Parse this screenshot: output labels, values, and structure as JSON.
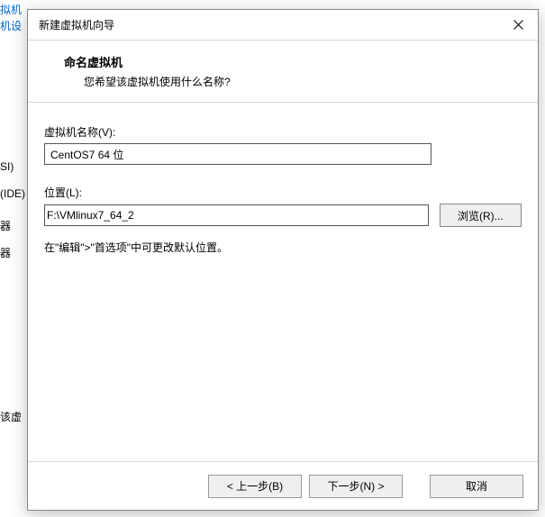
{
  "background": {
    "link1": "拟机",
    "link2": "机设",
    "frag_si": "SI)",
    "frag_ide": "(IDE)",
    "frag_qi1": "器",
    "frag_qi2": "器",
    "frag_gai": "该虚"
  },
  "dialog": {
    "title": "新建虚拟机向导",
    "heading": "命名虚拟机",
    "subheading": "您希望该虚拟机使用什么名称?",
    "name_label": "虚拟机名称(V):",
    "name_value": "CentOS7 64 位",
    "location_label": "位置(L):",
    "location_value": "F:\\VMlinux7_64_2",
    "browse_label": "浏览(R)...",
    "hint": "在\"编辑\">\"首选项\"中可更改默认位置。",
    "back_label": "< 上一步(B)",
    "next_label": "下一步(N) >",
    "cancel_label": "取消"
  }
}
